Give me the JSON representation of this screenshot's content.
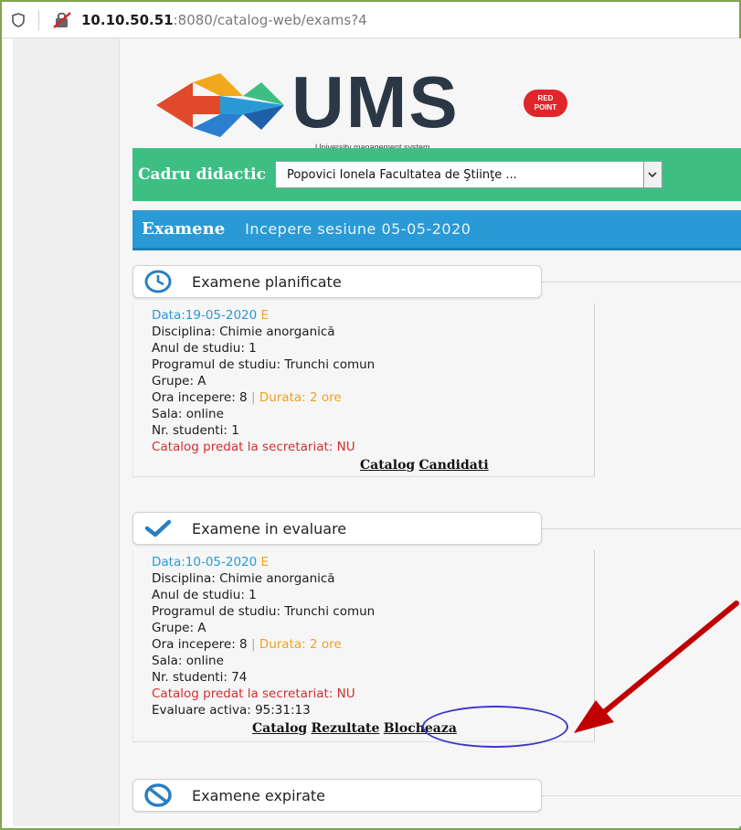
{
  "browser": {
    "url_host": "10.10.50.51",
    "url_rest": ":8080/catalog-web/exams?4"
  },
  "header": {
    "logo_text": "UMS",
    "logo_subtitle": "University management system",
    "badge_line1": "RED",
    "badge_line2": "POINT"
  },
  "teacher_bar": {
    "label": "Cadru didactic",
    "selected": "Popovici Ionela Facultatea de Ştiinţe ..."
  },
  "exams_bar": {
    "title": "Examene",
    "subtitle": "Incepere sesiune 05-05-2020"
  },
  "sections": {
    "planned": {
      "title": "Examene planificate",
      "card": {
        "date": "Data:19-05-2020",
        "flag": "E",
        "discipline": "Disciplina: Chimie anorganică",
        "year": "Anul de studiu: 1",
        "program": "Programul de studiu: Trunchi comun",
        "groups": "Grupe: A",
        "start": "Ora incepere: 8",
        "pipe": "|",
        "duration": "Durata: 2 ore",
        "room": "Sala: online",
        "students": "Nr. studenti: 1",
        "catalog_status": "Catalog predat la secretariat: NU",
        "link_catalog": "Catalog",
        "link_candidati": "Candidati"
      }
    },
    "evaluation": {
      "title": "Examene in evaluare",
      "card": {
        "date": "Data:10-05-2020",
        "flag": "E",
        "discipline": "Disciplina: Chimie anorganică",
        "year": "Anul de studiu: 1",
        "program": "Programul de studiu: Trunchi comun",
        "groups": "Grupe: A",
        "start": "Ora incepere: 8",
        "pipe": "|",
        "duration": "Durata: 2 ore",
        "room": "Sala: online",
        "students": "Nr. studenti: 74",
        "catalog_status": "Catalog predat la secretariat: NU",
        "active_eval": "Evaluare activa: 95:31:13",
        "link_catalog": "Catalog",
        "link_rezultate": "Rezultate",
        "link_blocheaza": "Blocheaza"
      }
    },
    "expired": {
      "title": "Examene expirate"
    }
  },
  "colors": {
    "green_bar": "#3dbf84",
    "blue_bar": "#2a9ad6",
    "annotation_arrow": "#c00000",
    "annotation_ellipse": "#3a38c8"
  }
}
